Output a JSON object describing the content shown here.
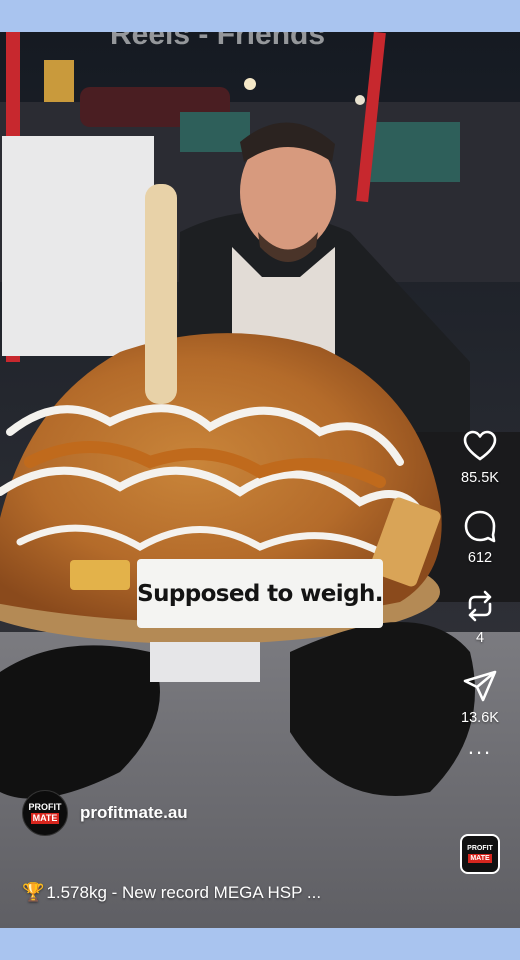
{
  "video": {
    "top_title_fragment": "Reels - Friends",
    "overlay_caption": "Supposed to weigh."
  },
  "actions": {
    "likes": "85.5K",
    "comments": "612",
    "reposts": "4",
    "shares": "13.6K",
    "more": "..."
  },
  "account": {
    "username": "profitmate.au",
    "logo_top": "PROFIT",
    "logo_box": "MATE"
  },
  "caption": {
    "icon": "trophy-icon",
    "text": "1.578kg - New record MEGA HSP ..."
  },
  "colors": {
    "page_background": "#a9c4ef",
    "overlay_box": "#f4f4f2",
    "brand_red": "#d7261e"
  }
}
